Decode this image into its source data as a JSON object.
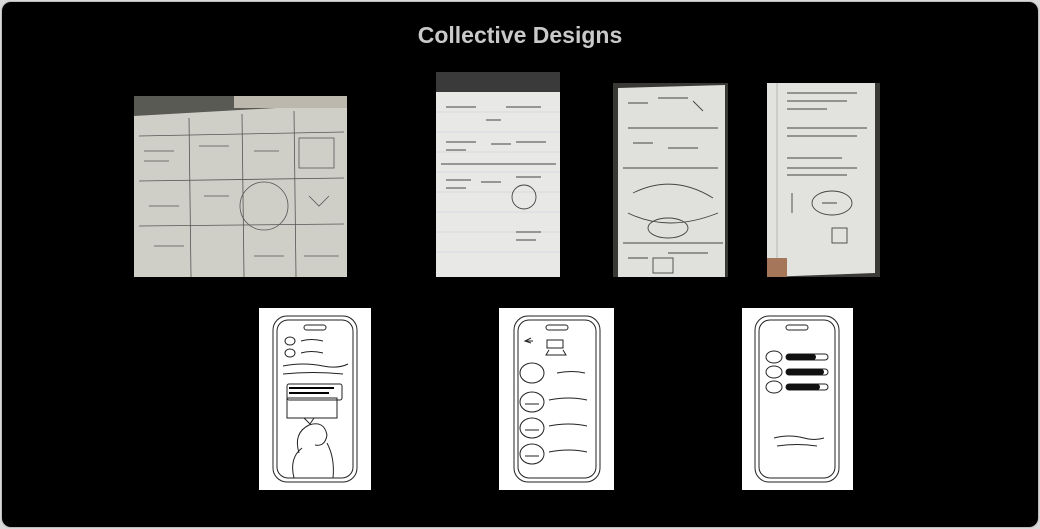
{
  "page": {
    "title": "Collective Designs"
  },
  "gallery": {
    "photos": [
      {
        "name": "notebook-sketch-grid"
      },
      {
        "name": "notebook-sketch-flow"
      },
      {
        "name": "notebook-sketch-journey"
      },
      {
        "name": "notebook-sketch-ideas"
      }
    ],
    "wireframes": [
      {
        "name": "phone-wireframe-feed"
      },
      {
        "name": "phone-wireframe-list"
      },
      {
        "name": "phone-wireframe-progress"
      }
    ]
  }
}
